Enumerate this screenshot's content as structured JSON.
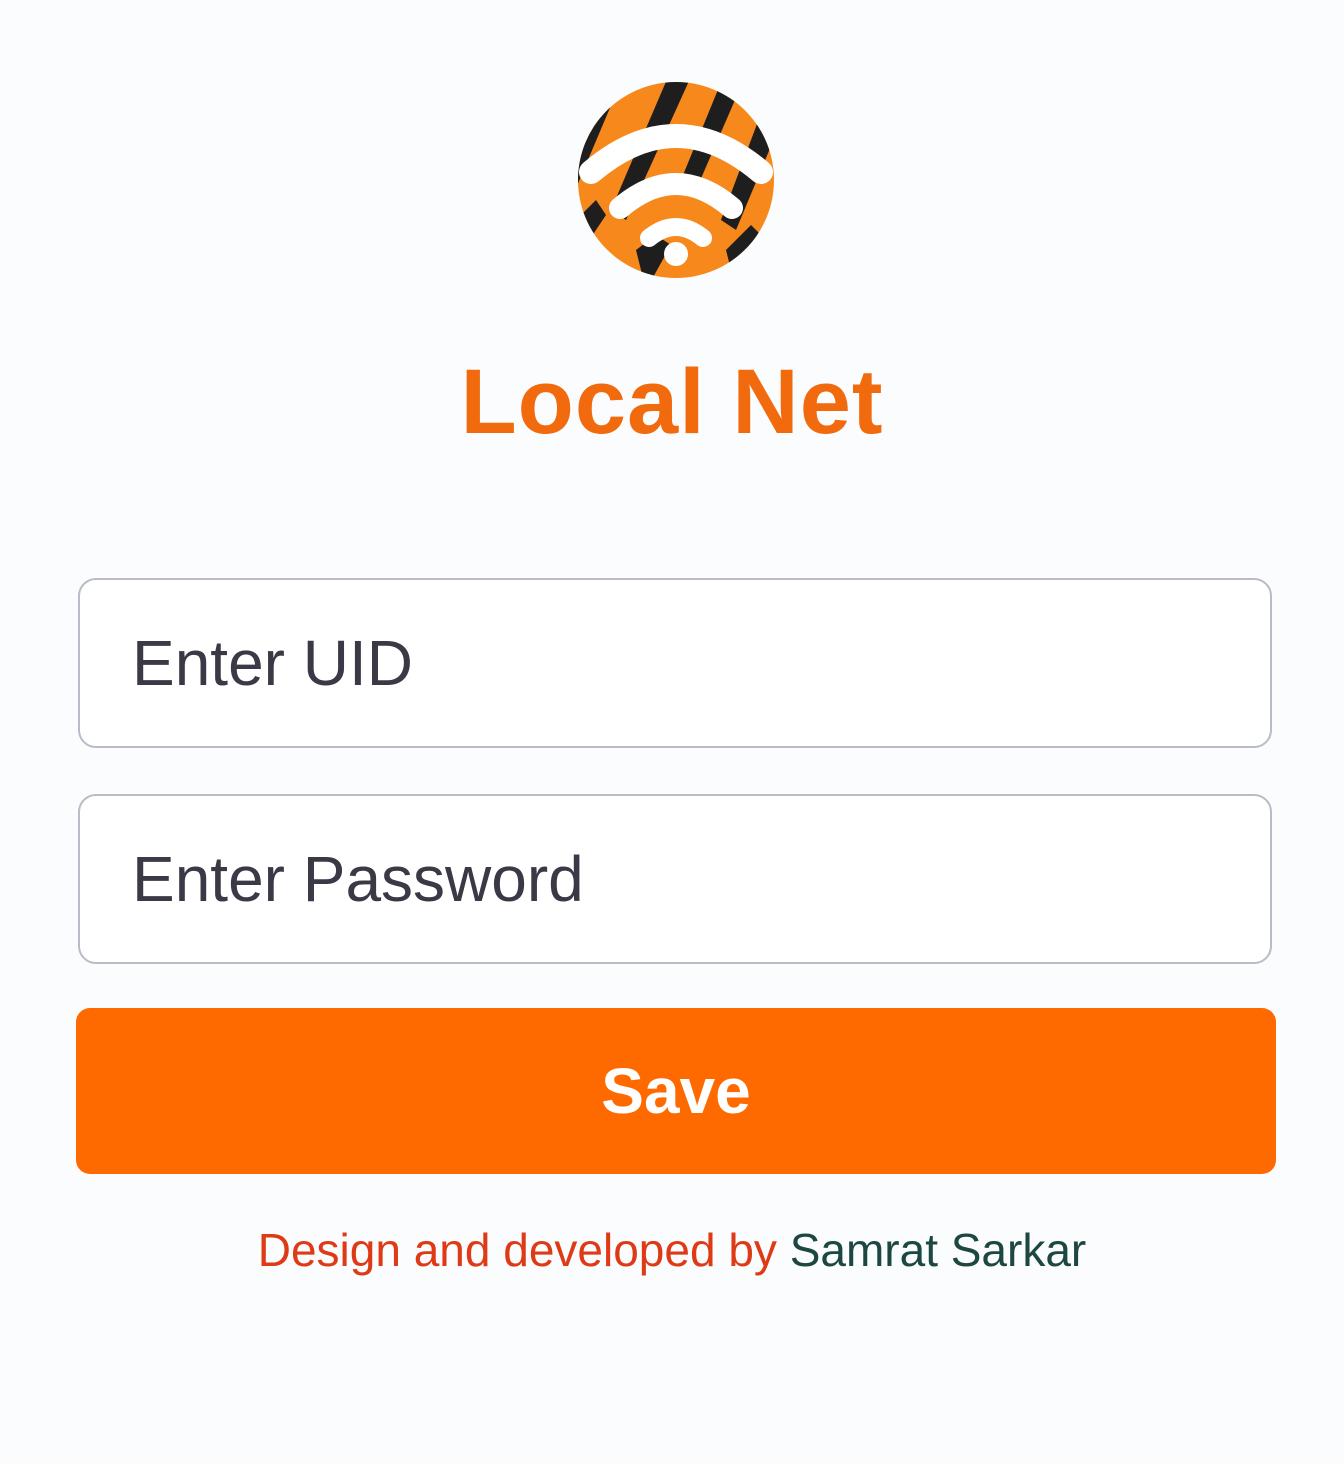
{
  "logo": {
    "icon": "wifi-icon",
    "bg_color": "#f7891c",
    "stripe_color": "#1e1e1e",
    "symbol_color": "#ffffff"
  },
  "app": {
    "title": "Local Net",
    "title_color": "#f26a0e"
  },
  "form": {
    "uid_placeholder": "Enter UID",
    "uid_value": "",
    "password_placeholder": "Enter Password",
    "password_value": "",
    "save_label": "Save",
    "button_color": "#ff6a00"
  },
  "footer": {
    "prefix": "Design and developed by ",
    "author": "Samrat Sarkar",
    "prefix_color": "#de3a16",
    "author_color": "#1d4741"
  }
}
